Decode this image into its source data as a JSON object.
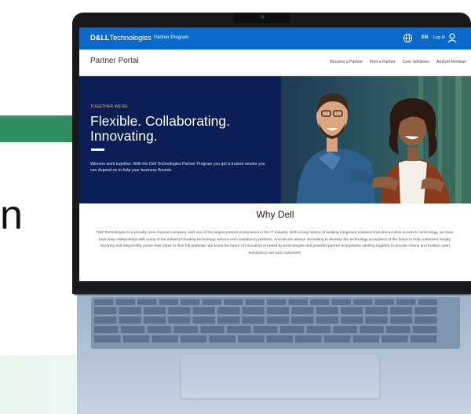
{
  "background": {
    "glyph": "n"
  },
  "topbar": {
    "brand_bold": "D&LL",
    "brand_light": "Technologies",
    "program": "Partner Program",
    "language": "EN",
    "login": "Log In"
  },
  "portal": {
    "title": "Partner Portal",
    "nav": [
      "Become a Partner",
      "Find a Partner",
      "Core Solutions",
      "Analyst Reviews"
    ]
  },
  "hero": {
    "eyebrow": "TOGETHER WE'RE",
    "headline": "Flexible. Collaborating. Innovating.",
    "body": "Winners work together. With the Dell Technologies Partner Program you get a trusted vendor you can depend on to help your business flourish."
  },
  "why": {
    "title": "Why Dell",
    "body": "Dell Technologies is a proudly omni-channel company, with one of the largest partner ecosystems in the IT industry. With a long history of building integrated solutions that democratize access to technology, we have built deep relationships with many of the industry's leading technology, service and consultancy partners. And we are always innovating to develop the technology ecosystem of the future to help customers simply, securely and responsibly power their ideas to their full potential. We know the future of innovation is fueled by technologies and powerful partner ecosystems working together to provide choice and trusted, open solutions to our joint customers."
  },
  "colors": {
    "dell_blue": "#0b6ac9",
    "hero_navy": "#0a1e55",
    "eyebrow_gold": "#e3c254",
    "slide_green": "#2f8f63"
  }
}
